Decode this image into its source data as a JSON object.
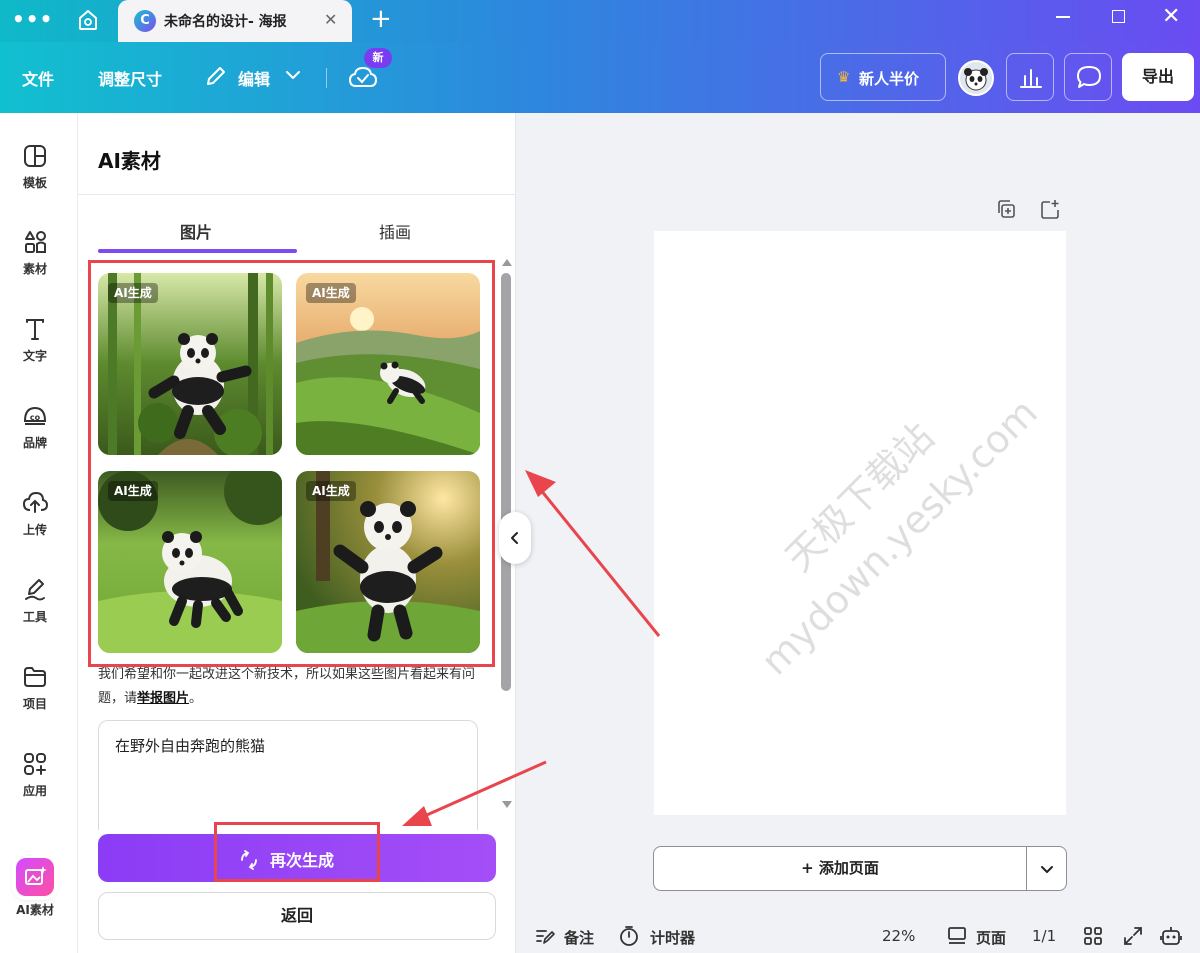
{
  "titlebar": {
    "tab_logo": "C",
    "tab_title": "未命名的设计- 海报"
  },
  "toolbar": {
    "file_label": "文件",
    "resize_label": "调整尺寸",
    "edit_label": "编辑",
    "new_badge": "新",
    "promo_label": "新人半价",
    "export_label": "导出"
  },
  "rail": {
    "items": [
      {
        "label": "模板",
        "icon": "layout-icon"
      },
      {
        "label": "素材",
        "icon": "elements-icon"
      },
      {
        "label": "文字",
        "icon": "text-icon"
      },
      {
        "label": "品牌",
        "icon": "brand-icon"
      },
      {
        "label": "上传",
        "icon": "upload-icon"
      },
      {
        "label": "工具",
        "icon": "draw-icon"
      },
      {
        "label": "项目",
        "icon": "folder-icon"
      },
      {
        "label": "应用",
        "icon": "apps-icon"
      },
      {
        "label": "AI素材",
        "icon": "ai-magic-icon"
      }
    ]
  },
  "panel": {
    "title": "AI素材",
    "tabs": [
      {
        "label": "图片",
        "active": true
      },
      {
        "label": "插画",
        "active": false
      }
    ],
    "images": [
      {
        "badge": "AI生成"
      },
      {
        "badge": "AI生成"
      },
      {
        "badge": "AI生成"
      },
      {
        "badge": "AI生成"
      }
    ],
    "notice_text": "我们希望和你一起改进这个新技术，所以如果这些图片看起来有问题，请",
    "notice_link": "举报图片",
    "notice_end": "。",
    "prompt_value": "在野外自由奔跑的熊猫",
    "regenerate_label": "再次生成",
    "back_label": "返回"
  },
  "canvas": {
    "watermark_line1": "天极下载站",
    "watermark_line2": "mydown.yesky.com",
    "add_page_label": "+ 添加页面"
  },
  "statusbar": {
    "notes_label": "备注",
    "timer_label": "计时器",
    "zoom": "22%",
    "pages_label": "页面",
    "page_count": "1/1"
  },
  "colors": {
    "accent": "#7c4cf0",
    "annotation_red": "#e8454d"
  }
}
